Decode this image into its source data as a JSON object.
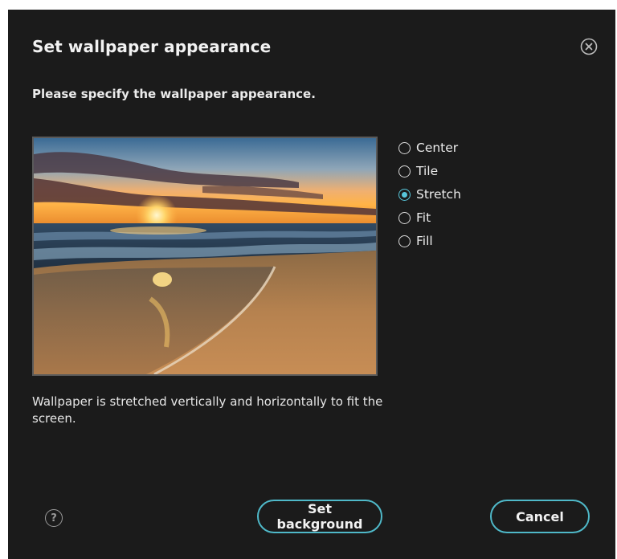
{
  "dialog": {
    "title": "Set wallpaper appearance",
    "subtitle": "Please specify the wallpaper appearance.",
    "description": "Wallpaper is stretched vertically and horizontally to fit the screen.",
    "help_label": "?"
  },
  "options": [
    {
      "label": "Center",
      "checked": false
    },
    {
      "label": "Tile",
      "checked": false
    },
    {
      "label": "Stretch",
      "checked": true
    },
    {
      "label": "Fit",
      "checked": false
    },
    {
      "label": "Fill",
      "checked": false
    }
  ],
  "buttons": {
    "set_background": "Set background",
    "cancel": "Cancel"
  },
  "colors": {
    "dialog_bg": "#1b1b1b",
    "accent": "#4fb9c9",
    "radio_selected": "#58c6da"
  },
  "icons": {
    "close": "close-circle-icon",
    "help": "help-circle-icon"
  }
}
